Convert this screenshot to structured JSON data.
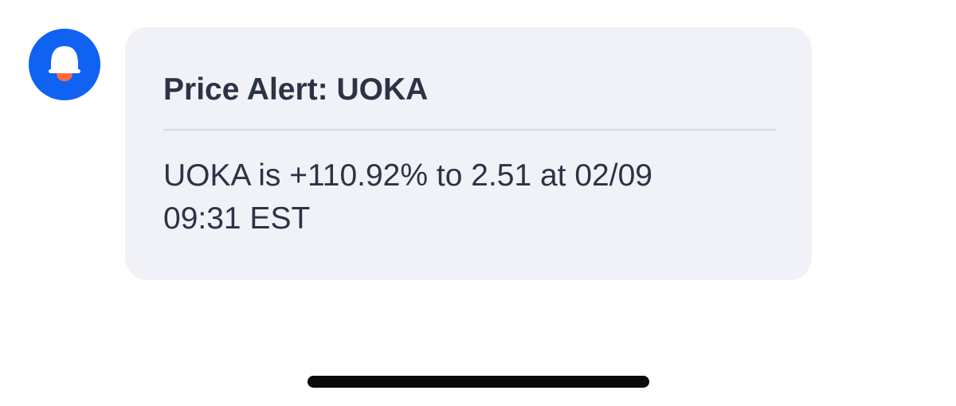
{
  "notification": {
    "icon": "bell-icon",
    "accent_color": "#0f62f2",
    "title": "Price Alert: UOKA",
    "body_line1": "UOKA is +110.92% to 2.51 at 02/09",
    "body_line2": "09:31 EST"
  }
}
